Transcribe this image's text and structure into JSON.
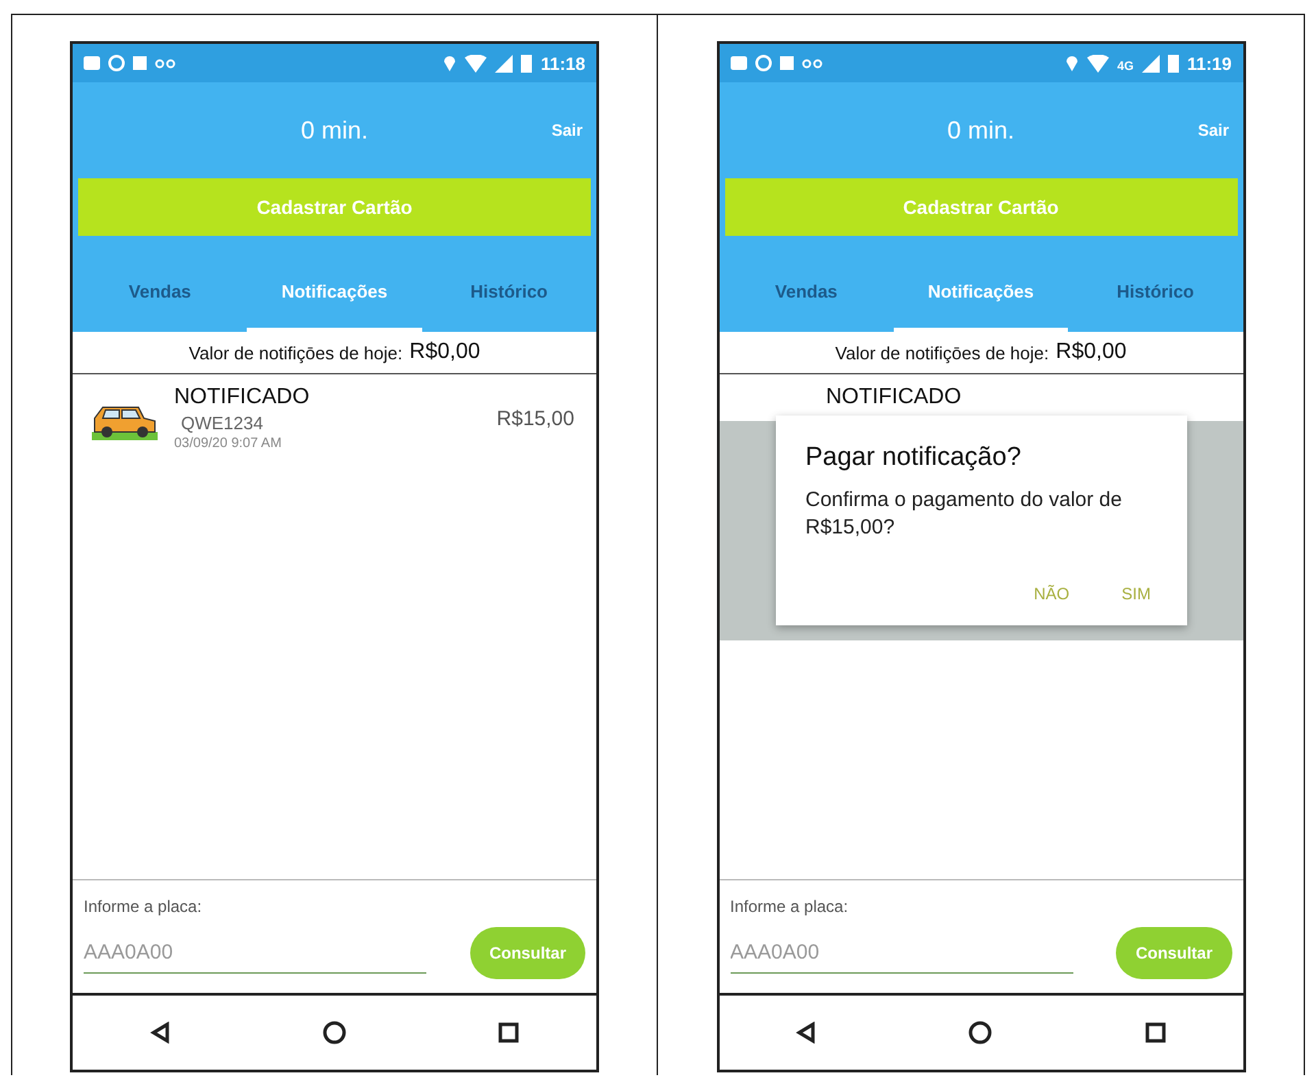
{
  "screens": [
    {
      "status": {
        "time": "11:18"
      },
      "header": {
        "title": "0 min.",
        "exit": "Sair"
      },
      "register_button": "Cadastrar Cartão",
      "tabs": [
        {
          "label": "Vendas",
          "selected": false
        },
        {
          "label": "Notificações",
          "selected": true
        },
        {
          "label": "Histórico",
          "selected": false
        }
      ],
      "summary": {
        "label": "Valor de notifiçōes de hoje:",
        "value": "R$0,00"
      },
      "notifications": [
        {
          "status": "NOTIFICADO",
          "plate": "QWE1234",
          "datetime": "03/09/20 9:07 AM",
          "amount": "R$15,00"
        }
      ],
      "plate_form": {
        "label": "Informe a placa:",
        "placeholder": "AAA0A00",
        "button": "Consultar"
      }
    },
    {
      "status": {
        "network": "4G",
        "time": "11:19"
      },
      "header": {
        "title": "0 min.",
        "exit": "Sair"
      },
      "register_button": "Cadastrar Cartão",
      "tabs": [
        {
          "label": "Vendas",
          "selected": false
        },
        {
          "label": "Notificações",
          "selected": true
        },
        {
          "label": "Histórico",
          "selected": false
        }
      ],
      "summary": {
        "label": "Valor de notifiçōes de hoje:",
        "value": "R$0,00"
      },
      "notifications": [
        {
          "status": "NOTIFICADO"
        }
      ],
      "dialog": {
        "title": "Pagar notificação?",
        "message": "Confirma o pagamento do valor de R$15,00?",
        "buttons": [
          "NÃO",
          "SIM"
        ]
      },
      "plate_form": {
        "label": "Informe a placa:",
        "placeholder": "AAA0A00",
        "button": "Consultar"
      }
    }
  ]
}
